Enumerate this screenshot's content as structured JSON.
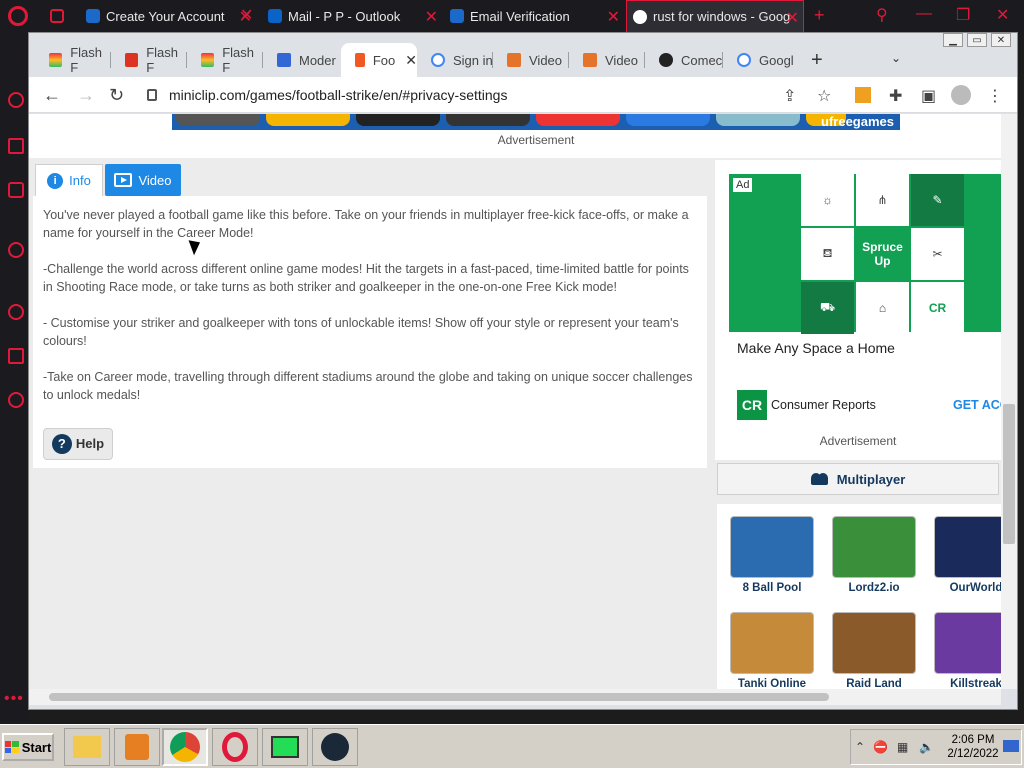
{
  "opera": {
    "tabs": [
      {
        "label": "",
        "close": "✕"
      },
      {
        "label": "Create Your Account",
        "close": "✕"
      },
      {
        "label": "Mail - P P - Outlook",
        "close": "✕"
      },
      {
        "label": "Email Verification",
        "close": "✕"
      },
      {
        "label": "rust for windows - Goog",
        "close": "✕"
      }
    ],
    "newtab": "+",
    "colors": {
      "accent": "#e0193a",
      "background": "#1b1b1f"
    }
  },
  "chrome": {
    "tabs": [
      {
        "label": "Flash F",
        "icon": "rainbow-icon"
      },
      {
        "label": "Flash F",
        "icon": "flash-icon"
      },
      {
        "label": "Flash F",
        "icon": "rainbow-icon"
      },
      {
        "label": "Moder",
        "icon": "m-blue-icon"
      },
      {
        "label": "Foo",
        "icon": "miniclip-icon",
        "active": true
      },
      {
        "label": "Sign in",
        "icon": "google-icon"
      },
      {
        "label": "Video",
        "icon": "v-orange-icon"
      },
      {
        "label": "Video",
        "icon": "v-orange-icon"
      },
      {
        "label": "Comec",
        "icon": "github-icon"
      },
      {
        "label": "Googl",
        "icon": "google-icon"
      }
    ],
    "active_close": "✕",
    "newtab": "+",
    "tabsearch": "⌄",
    "url": "miniclip.com/games/football-strike/en/#privacy-settings"
  },
  "page": {
    "top_banner_text": "ufreegames",
    "advertisement_label": "Advertisement",
    "info_tab": "Info",
    "video_tab": "Video",
    "description": [
      "You've never played a football game like this before. Take on your friends in multiplayer free-kick face-offs, or make a name for yourself in the Career Mode!",
      "-Challenge the world across different online game modes! Hit the targets in a fast-paced, time-limited battle for points in Shooting Race mode, or take turns as both striker and goalkeeper in the one-on-one Free Kick mode!",
      "- Customise your striker and goalkeeper with tons of unlockable items! Show off your style or represent your team's colours!",
      "-Take on Career mode, travelling through different stadiums around the globe and taking on unique soccer challenges to unlock medals!"
    ],
    "help_label": "Help",
    "ad": {
      "badge": "Ad",
      "spruce": "Spruce Up",
      "cr_cell": "CR",
      "headline": "Make Any Space a Home",
      "brand": "Consumer Reports",
      "brand_logo": "CR",
      "cta": "GET ACC"
    },
    "advertisement_label2": "Advertisement",
    "multiplayer_label": "Multiplayer",
    "games": [
      {
        "name": "8 Ball Pool",
        "color": "#2b6cb0"
      },
      {
        "name": "Lordz2.io",
        "color": "#3a8f3a"
      },
      {
        "name": "OurWorld",
        "color": "#1a2a5a"
      },
      {
        "name": "Tanki Online",
        "color": "#c58a3a"
      },
      {
        "name": "Raid Land",
        "color": "#8a5a2a"
      },
      {
        "name": "Killstreak",
        "color": "#6a3aa0"
      }
    ]
  },
  "taskbar": {
    "start": "Start",
    "time": "2:06 PM",
    "date": "2/12/2022"
  }
}
